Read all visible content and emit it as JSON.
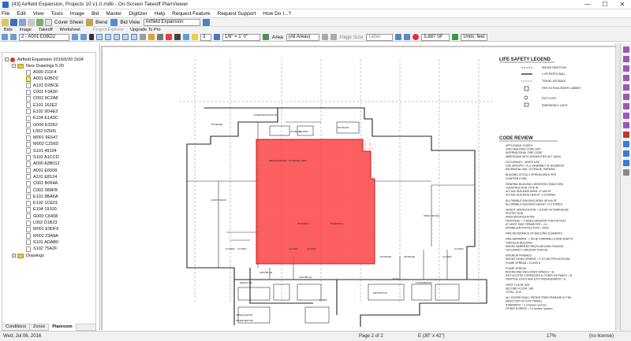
{
  "window": {
    "title": "[43] Airfield Expansion, Projects 10 v1.0.mdb - On-Screen Takeoff PlanViewer",
    "minimize": "—",
    "maximize": "☐",
    "close": "✕"
  },
  "menu": [
    "File",
    "Edit",
    "View",
    "Tools",
    "Image",
    "Bid",
    "Master",
    "Digitizer",
    "Help",
    "Request Feature",
    "Request Support",
    "How Do I...?"
  ],
  "toolbar1": {
    "cover_sheet": "Cover Sheet",
    "bend": "Bend",
    "bid_view": "Bid View",
    "bid_combo": "Airfield Expansion"
  },
  "tabs": [
    "Bids",
    "Image",
    "Takeoff",
    "Worksheet",
    "Project Explorer",
    "Upgrade To Pro"
  ],
  "toolbar2": {
    "page_combo": "2 - A001 E0BD2",
    "zoom": "3",
    "scale": "1/8\" = 1' 0\"",
    "area_label": "Area",
    "area_combo": "(All Areas)",
    "page_size_label": "Page Size",
    "page_size": "Letter",
    "sf_value": "5,887 SF",
    "units": "Units: feet"
  },
  "tree": {
    "project": "Airfield Expansion 2016/6/30 1634",
    "folder_new": "New Drawings 5-20",
    "pages": [
      "A000 211F4",
      "A001 E0BD2",
      "A101 D2BCE",
      "C001 F3A30",
      "C002 9C2A8",
      "E101 162E2",
      "E102 9D4E3",
      "E104 E1A3C",
      "G000 E3262",
      "L002 02505",
      "M001 9E547",
      "M002 C256D",
      "S101 49194",
      "S102 A1CCD",
      "A000 A2B012",
      "A001 E6508",
      "A101 E8124",
      "C001 B064A",
      "C002 989FB",
      "E101 8BA6A",
      "E102 1CE01",
      "E104 19100",
      "G000 C6408",
      "L002 D1B23",
      "M001 E9DF6",
      "M002 23A8A",
      "S101 ADAB0",
      "S102 75A2F"
    ],
    "selected_index": 1,
    "folder_drawings": "Drawings"
  },
  "bottom_tabs": [
    "Conditions",
    "Zones",
    "Planroom"
  ],
  "status": {
    "date": "Wed, Jul 06, 2016",
    "page": "Page 2 of 2",
    "paper": "E (30\" x 42\")",
    "zoom_pct": "17%",
    "license": "(no license)"
  },
  "drawing": {
    "legend_title": "LIFE SAFETY LEGEND",
    "legend_items": [
      "SMOKE PARTITION",
      "1-HR RATED WALL",
      "TRAVEL DISTANCE",
      "FIRE EXTINGUISHER CABINET",
      "EXIT LIGHT",
      "EMERGENCY LIGHT"
    ],
    "code_title": "CODE REVIEW",
    "code_lines": [
      "APPLICABLE CODES:",
      "OHIO BUILDING CODE 2007",
      "INTERNATIONAL FIRE CODE",
      "AMERICANS WITH DISABILITIES ACT (ADA)",
      "",
      "OCCUPANCY - MIXED USE",
      "USE GROUPS = A-3: ASSEMBLY, B: BUSINESS",
      "INCIDENTAL USE: STORAGE, PARKING",
      "",
      "BUILDING IS FULLY SPRINKLERED PER",
      "CHAPTER 9 OBC",
      "",
      "GENERAL BUILDING LIMITATION (TABLE 503)",
      "CONSTRUCTION TYPE IB",
      "ACTUAL BUILDING AREA: 47,445 SF",
      "ACTUAL BUILDING HEIGHT: 2 STORIES",
      "",
      "ALLOWABLE BUILDING AREA: 89,844 SF",
      "ALLOWABLE BUILDING HEIGHT: 11 STORIES",
      "",
      "HEIGHT MODIFICATION: 1 STORY W/ SPRINKLER",
      "PROTECTION",
      "AREA MODIFICATIONS",
      "FRONTAGE = 3 SIDES GREATER THAN 30 FEET",
      "AT MOST SIDE PERIMETER = 4.0",
      "SPRINKLER PROTECTION = 200%",
      "",
      "FIRE RESISTANCE OF BUILDING ELEMENTS",
      "",
      "FIRE BARRIERS - 1 HR @ STAIRWELLS AND SHAFTS",
      "THROUGH BUILDING",
      "SMOKE BARRIERS REQ'D AROUND STAGING",
      "OCCUPANCY GREATER THAN 50",
      "",
      "INTERIOR FINISHES",
      "SMOKE DEVELOPMENT = 0 TO 450 PER ASTM E84",
      "FLAME SPREAD = CLASS A",
      "",
      "FLAME SPREAD",
      "ROOMS AND ENCLOSED SPACES = B",
      "EXIT ACCESS CORRIDORS & OTHER EXITWAYS = B",
      "VERTICAL EXITS AND EXIT PASSAGEWAYS = A",
      "",
      "FIRST FLOOR: 825",
      "SECOND FLOOR: 188",
      "TOTAL: 1013",
      "",
      "ALL DOORS SHALL PERMIT FREE PASSAGE IN THE",
      "DIRECTION OF EXIT TRAVEL",
      "STAIRWAYS = 0.3 inches / person",
      "OTHER EGRESS = 0.2 inches / person"
    ],
    "room_labels": [
      "COMMUNICATION RM",
      "STORAGE",
      "STORAGE",
      "STORAGE",
      "CLOSET",
      "MERCHANDISE / STORAGE AREA",
      "AUDITORIUM",
      "TRAINING 1",
      "TRAINING 2",
      "OPEN OFFICE",
      "CLOSET",
      "CLOSET",
      "CLOSET",
      "CLOSET",
      "VESTIBULE",
      "BREAK RM",
      "CONFERENCE",
      "VESTIBULE",
      "LOBBY",
      "BREAK ROOM",
      "INTERVIEW RM",
      "STORAGE",
      "STORAGE",
      "CLOSET",
      "CLOSET",
      "RECEPTION",
      "ELEV"
    ]
  },
  "colors": {
    "highlight_fill": "#ff3b3b",
    "highlight_stroke": "#c01a1a",
    "folder": "#e8c44a",
    "selected_page": "#f7ec62"
  }
}
